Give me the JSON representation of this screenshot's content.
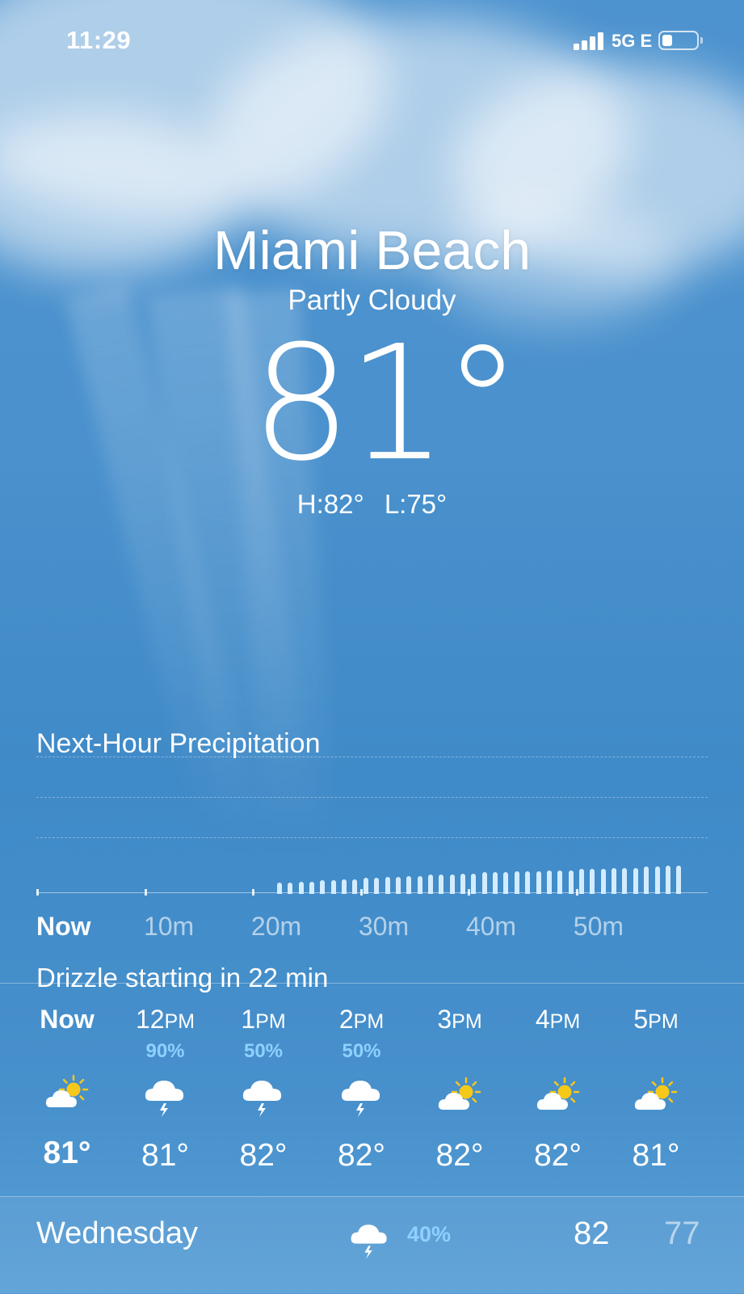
{
  "status_bar": {
    "time": "11:29",
    "network": "5G E",
    "signal_bars": 4,
    "battery_level": 0.3
  },
  "current": {
    "city": "Miami Beach",
    "condition": "Partly Cloudy",
    "temperature": "81°",
    "high": "H:82°",
    "low": "L:75°"
  },
  "precipitation": {
    "title": "Next-Hour Precipitation",
    "axis_labels": [
      "Now",
      "10m",
      "20m",
      "30m",
      "40m",
      "50m"
    ],
    "summary": "Drizzle starting in 22 min",
    "intensity_series": {
      "start_minute": 22,
      "values": [
        0.1,
        0.1,
        0.11,
        0.11,
        0.12,
        0.12,
        0.13,
        0.13,
        0.14,
        0.14,
        0.15,
        0.15,
        0.16,
        0.16,
        0.17,
        0.17,
        0.17,
        0.18,
        0.18,
        0.19,
        0.19,
        0.19,
        0.2,
        0.2,
        0.2,
        0.21,
        0.21,
        0.21,
        0.22,
        0.22,
        0.22,
        0.23,
        0.23,
        0.23,
        0.24,
        0.24,
        0.25,
        0.25
      ]
    }
  },
  "hourly": [
    {
      "time": "Now",
      "chance": "",
      "icon": "partly-cloudy-icon",
      "temp": "81°"
    },
    {
      "time": "12PM",
      "chance": "90%",
      "icon": "thunderstorm-icon",
      "temp": "81°"
    },
    {
      "time": "1PM",
      "chance": "50%",
      "icon": "thunderstorm-icon",
      "temp": "82°"
    },
    {
      "time": "2PM",
      "chance": "50%",
      "icon": "thunderstorm-icon",
      "temp": "82°"
    },
    {
      "time": "3PM",
      "chance": "",
      "icon": "partly-cloudy-icon",
      "temp": "82°"
    },
    {
      "time": "4PM",
      "chance": "",
      "icon": "partly-cloudy-icon",
      "temp": "82°"
    },
    {
      "time": "5PM",
      "chance": "",
      "icon": "partly-cloudy-icon",
      "temp": "81°"
    }
  ],
  "daily": [
    {
      "day": "Wednesday",
      "icon": "thunderstorm-icon",
      "chance": "40%",
      "high": "82",
      "low": "77"
    }
  ],
  "colors": {
    "chance_text": "#8fd0ff",
    "sun": "#f6c81a",
    "precip_bar": "#d3ecff"
  }
}
